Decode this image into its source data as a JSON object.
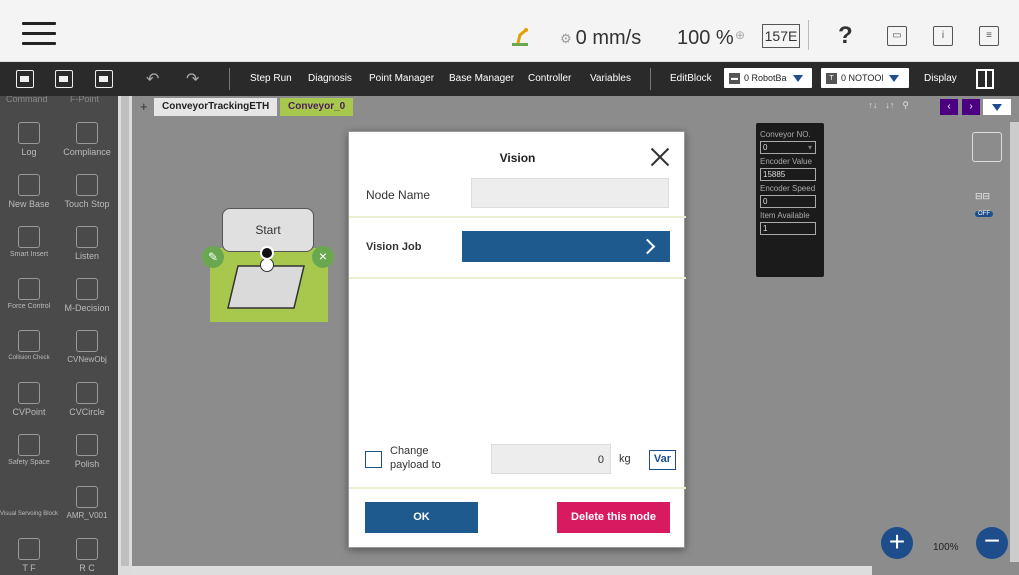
{
  "topbar": {
    "speed": "0 mm/s",
    "percent": "100 %",
    "badge": "157E",
    "help": "?"
  },
  "toolbar": {
    "items": [
      "Step Run",
      "Diagnosis",
      "Point Manager",
      "Base Manager",
      "Controller",
      "Variables",
      "EditBlock"
    ],
    "base_select": "0 RobotBa",
    "tool_select": "0 NOTOOl",
    "tool_prefix": "T",
    "display": "Display"
  },
  "palette": {
    "header": [
      "Command",
      "F-Point"
    ],
    "items": [
      "Log",
      "Compliance",
      "New Base",
      "Touch Stop",
      "Smart Insert",
      "Listen",
      "Force Control",
      "M-Decision",
      "Collision Check",
      "CVNewObj",
      "CVPoint",
      "CVCircle",
      "Safety Space",
      "Polish",
      "Visual Servoing Block",
      "AMR_V001",
      "T F",
      "R C"
    ]
  },
  "canvas": {
    "tabs": [
      "ConveyorTrackingETH",
      "Conveyor_0"
    ],
    "start_label": "Start",
    "zoom": "100%",
    "conveyor": {
      "no_label": "Conveyor NO.",
      "no_value": "0",
      "encoder_label": "Encoder Value",
      "encoder_value": "15885",
      "speed_label": "Encoder Speed",
      "speed_value": "0",
      "item_label": "Item Available",
      "item_value": "1"
    },
    "toggle": "OFF"
  },
  "modal": {
    "title": "Vision",
    "node_name_label": "Node Name",
    "node_name_value": "",
    "vision_job_label": "Vision Job",
    "change_payload_label": "Change payload to",
    "payload_value": "0",
    "payload_unit": "kg",
    "var_button": "Var",
    "ok_button": "OK",
    "delete_button": "Delete this node"
  },
  "colors": {
    "accent_blue": "#1e5a8e",
    "delete_pink": "#d81b60",
    "node_green": "#a7c84d"
  }
}
